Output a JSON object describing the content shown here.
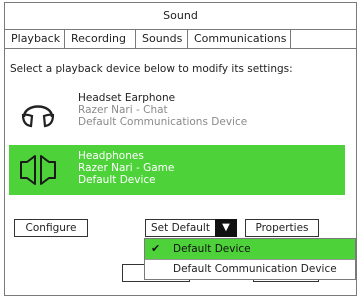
{
  "window": {
    "title": "Sound"
  },
  "tabs": [
    {
      "label": "Playback",
      "active": true
    },
    {
      "label": "Recording",
      "active": false
    },
    {
      "label": "Sounds",
      "active": false
    },
    {
      "label": "Communications",
      "active": false
    }
  ],
  "instruction": "Select a playback device below to modify its settings:",
  "devices": [
    {
      "icon": "headset-icon",
      "name": "Headset Earphone",
      "line2": "Razer Nari - Chat",
      "line3": "Default Communications Device",
      "selected": false
    },
    {
      "icon": "speaker-pair-icon",
      "name": "Headphones",
      "line2": "Razer Nari - Game",
      "line3": "Default Device",
      "selected": true
    }
  ],
  "buttons": {
    "configure": "Configure",
    "set_default": "Set Default",
    "properties": "Properties"
  },
  "dropdown_menu": {
    "items": [
      {
        "label": "Default Device",
        "checked": true
      },
      {
        "label": "Default Communication Device",
        "checked": false
      }
    ]
  },
  "colors": {
    "accent": "#4ed23a",
    "border": "#7a7a7a"
  }
}
